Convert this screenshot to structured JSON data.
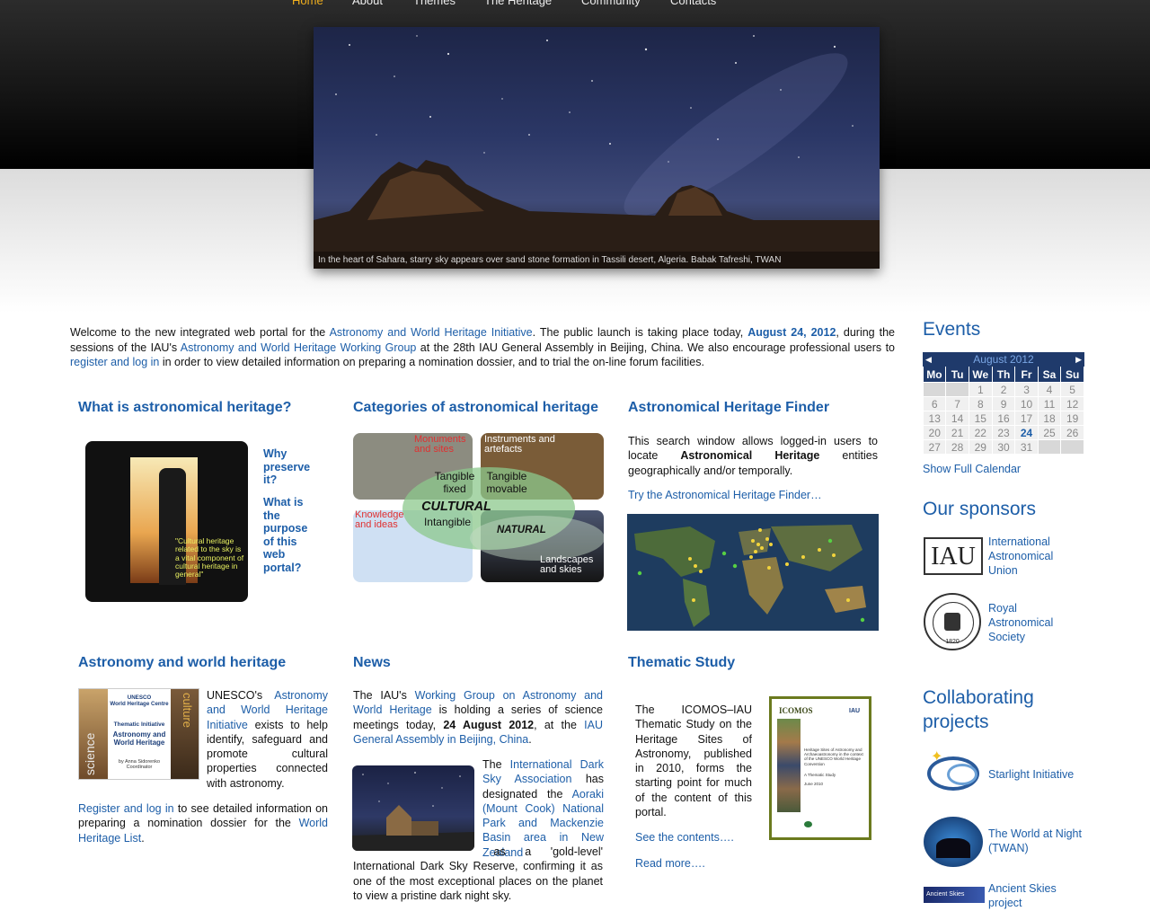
{
  "nav": [
    "Home",
    "About",
    "Themes",
    "The Heritage",
    "Community",
    "Contacts"
  ],
  "hero_caption": "In the heart of Sahara, starry sky appears over sand stone formation in Tassili desert, Algeria. Babak Tafreshi, TWAN",
  "welcome": {
    "t1": "Welcome to the new integrated web portal for the ",
    "l1": "Astronomy and World Heritage Initiative",
    "t2": ". The public launch is taking place today, ",
    "date": "August 24, 2012",
    "t3": ", during the sessions of the IAU's ",
    "l2": "Astronomy and World Heritage Working Group",
    "t4": " at the 28th IAU General Assembly in Beijing, China. We also encourage professional users to ",
    "l3": "register and log in",
    "t5": " in order to view detailed information on preparing a nomination dossier, and to trial the on-line forum facilities."
  },
  "col1": {
    "title": "What is astronomical heritage?",
    "q1": "Why preserve it?",
    "q2": "What is the purpose of this web portal?",
    "quote": "\"Cultural heritage related to the sky is a vital component of cultural heritage in general\""
  },
  "col2": {
    "title": "Categories of astronomical heritage",
    "monuments": "Monuments and sites",
    "instruments": "Instruments and artefacts",
    "tangible_fixed": "Tangible fixed",
    "tangible_movable": "Tangible movable",
    "cultural": "CULTURAL",
    "intangible": "Intangible",
    "knowledge": "Knowledge and ideas",
    "natural": "NATURAL",
    "landscapes": "Landscapes and skies"
  },
  "col3": {
    "title": "Astronomical Heritage Finder",
    "t1": "This search window allows logged-in users to locate ",
    "bold": "Astronomical Heritage",
    "t2": " entities geographically and/or temporally.",
    "link": "Try the Astronomical Heritage Finder…"
  },
  "row2c1": {
    "title": "Astronomy and world heritage",
    "t1": "UNESCO's ",
    "l1": "Astronomy and World Heritage Initiative",
    "t2": " exists to help identify, safeguard and promote cultural properties connected with astronomy.",
    "l2": "Register and log in",
    "t3": " to see detailed information on preparing a nomination dossier for the ",
    "l3": "World Heritage List",
    "t4": ".",
    "book_l1": "UNESCO",
    "book_l2": "World Heritage Centre",
    "book_l3": "Thematic Initiative",
    "book_l4": "Astronomy and World Heritage",
    "book_l5": "by Anna Sidorenko Coordinator",
    "book_side1": "science",
    "book_side2": "culture"
  },
  "news": {
    "title": "News",
    "t1": "The IAU's ",
    "l1": "Working Group on Astronomy and World Heritage",
    "t2": " is holding a series of science meetings today, ",
    "bold": "24 August 2012",
    "t3": ", at the ",
    "l2": "IAU General Assembly in Beijing, China",
    "t4": ".",
    "p2t1": "The ",
    "p2l1": "International Dark Sky Association",
    "p2t2": " has designated the ",
    "p2l2": "Aoraki (Mount Cook) National Park and Mackenzie Basin area in New Zealand",
    "p2t3": " as a 'gold-level' International Dark Sky Reserve, confirming it as one of the most exceptional places on the planet to view a pristine dark night sky."
  },
  "thematic": {
    "title": "Thematic Study",
    "text": "The ICOMOS–IAU Thematic Study on the Heritage Sites of Astronomy, published in 2010, forms the starting point for much of the content of this portal.",
    "l1": "See the contents….",
    "l2": "Read more….",
    "cover_title": "ICOMOS",
    "cover_iau": "IAU",
    "cover_sub": "Heritage Sites of Astronomy and Archaeoastronomy in the context of the UNESCO World Heritage Convention",
    "cover_study": "A Thematic Study",
    "cover_date": "June 2010"
  },
  "events": {
    "title": "Events",
    "month": "August 2012",
    "days": [
      "Mo",
      "Tu",
      "We",
      "Th",
      "Fr",
      "Sa",
      "Su"
    ],
    "weeks": [
      [
        "",
        "",
        "1",
        "2",
        "3",
        "4",
        "5"
      ],
      [
        "6",
        "7",
        "8",
        "9",
        "10",
        "11",
        "12"
      ],
      [
        "13",
        "14",
        "15",
        "16",
        "17",
        "18",
        "19"
      ],
      [
        "20",
        "21",
        "22",
        "23",
        "24",
        "25",
        "26"
      ],
      [
        "27",
        "28",
        "29",
        "30",
        "31",
        "",
        ""
      ]
    ],
    "today": "24",
    "show_full": "Show Full Calendar"
  },
  "sponsors": {
    "title": "Our sponsors",
    "iau": "International Astronomical Union",
    "iau_logo": "IAU",
    "ras": "Royal Astronomical Society",
    "ras_year": "1820"
  },
  "collab": {
    "title": "Collaborating projects",
    "p1": "Starlight Initiative",
    "p2": "The World at Night (TWAN)",
    "p3": "Ancient Skies project",
    "p3_logo": "Ancient Skies"
  },
  "colors": {
    "link": "#1d5ea8",
    "nav_active": "#f2b01e",
    "cal_head": "#1f3a6b",
    "green_border": "#6b7a1e"
  },
  "icons": [
    "calendar-prev-arrow-icon",
    "calendar-next-arrow-icon",
    "iau-logo-icon",
    "ras-seal-icon",
    "starlight-logo-icon",
    "twan-logo-icon",
    "ancient-skies-logo-icon"
  ]
}
